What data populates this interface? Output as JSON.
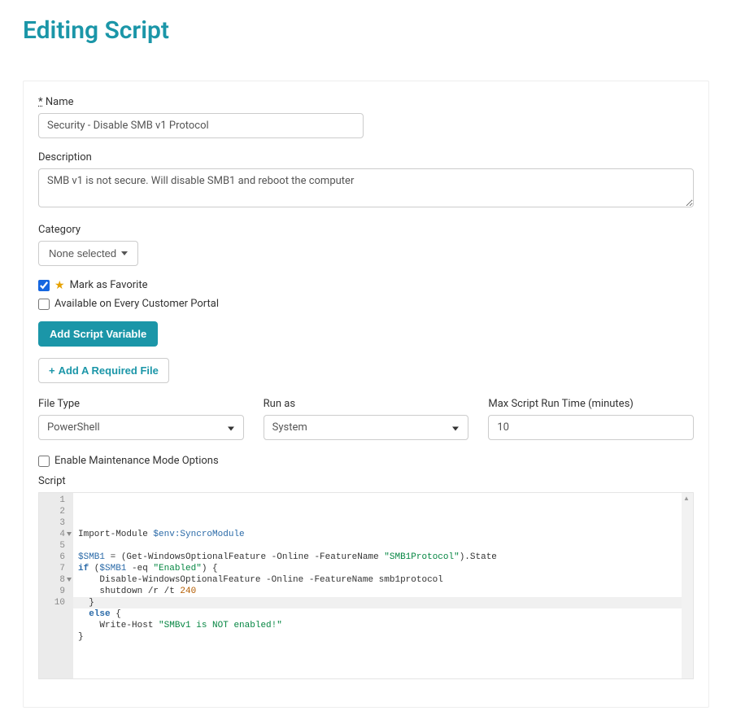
{
  "page_title": "Editing Script",
  "fields": {
    "name_label": "Name",
    "name_required_prefix": "*",
    "name_value": "Security - Disable SMB v1 Protocol",
    "description_label": "Description",
    "description_value": "SMB v1 is not secure. Will disable SMB1 and reboot the computer",
    "category_label": "Category",
    "category_selected": "None selected",
    "favorite_label": "Mark as Favorite",
    "favorite_checked": true,
    "portal_label": "Available on Every Customer Portal",
    "portal_checked": false,
    "add_variable_label": "Add Script Variable",
    "add_file_label": "Add A Required File",
    "filetype_label": "File Type",
    "filetype_value": "PowerShell",
    "runas_label": "Run as",
    "runas_value": "System",
    "maxtime_label": "Max Script Run Time (minutes)",
    "maxtime_value": "10",
    "maint_label": "Enable Maintenance Mode Options",
    "maint_checked": false,
    "script_label": "Script"
  },
  "script_lines": [
    {
      "n": 1,
      "text": "Import-Module $env:SyncroModule",
      "fold": false
    },
    {
      "n": 2,
      "text": "",
      "fold": false
    },
    {
      "n": 3,
      "text": "$SMB1 = (Get-WindowsOptionalFeature -Online -FeatureName \"SMB1Protocol\").State",
      "fold": false
    },
    {
      "n": 4,
      "text": "if ($SMB1 -eq \"Enabled\") {",
      "fold": true
    },
    {
      "n": 5,
      "text": "    Disable-WindowsOptionalFeature -Online -FeatureName smb1protocol",
      "fold": false
    },
    {
      "n": 6,
      "text": "    shutdown /r /t 240",
      "fold": false
    },
    {
      "n": 7,
      "text": "  }",
      "fold": false
    },
    {
      "n": 8,
      "text": "  else {",
      "fold": true
    },
    {
      "n": 9,
      "text": "    Write-Host \"SMBv1 is NOT enabled!\"",
      "fold": false
    },
    {
      "n": 10,
      "text": "}",
      "fold": false
    }
  ],
  "active_line": 10
}
